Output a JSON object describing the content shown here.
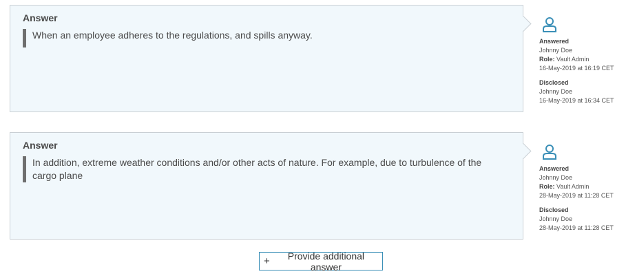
{
  "answers": [
    {
      "heading": "Answer",
      "text": "When an employee adheres to the regulations, and spills anyway.",
      "meta": {
        "answered_label": "Answered",
        "answered_by": "Johnny Doe",
        "role_label": "Role:",
        "role": "Vault Admin",
        "answered_at": "16-May-2019 at 16:19 CET",
        "disclosed_label": "Disclosed",
        "disclosed_by": "Johnny Doe",
        "disclosed_at": "16-May-2019 at 16:34 CET"
      }
    },
    {
      "heading": "Answer",
      "text": "In addition, extreme weather conditions and/or other acts of nature. For example, due to turbulence of the cargo plane",
      "meta": {
        "answered_label": "Answered",
        "answered_by": "Johnny Doe",
        "role_label": "Role:",
        "role": "Vault Admin",
        "answered_at": "28-May-2019 at 11:28 CET",
        "disclosed_label": "Disclosed",
        "disclosed_by": "Johnny Doe",
        "disclosed_at": "28-May-2019 at 11:28 CET"
      }
    }
  ],
  "add_button": {
    "plus": "+",
    "label": "Provide additional answer"
  },
  "icons": {
    "user": "user-icon"
  },
  "colors": {
    "card_bg": "#f1f8fc",
    "accent": "#3a8fb7",
    "quote_bar": "#6f6f6f"
  }
}
